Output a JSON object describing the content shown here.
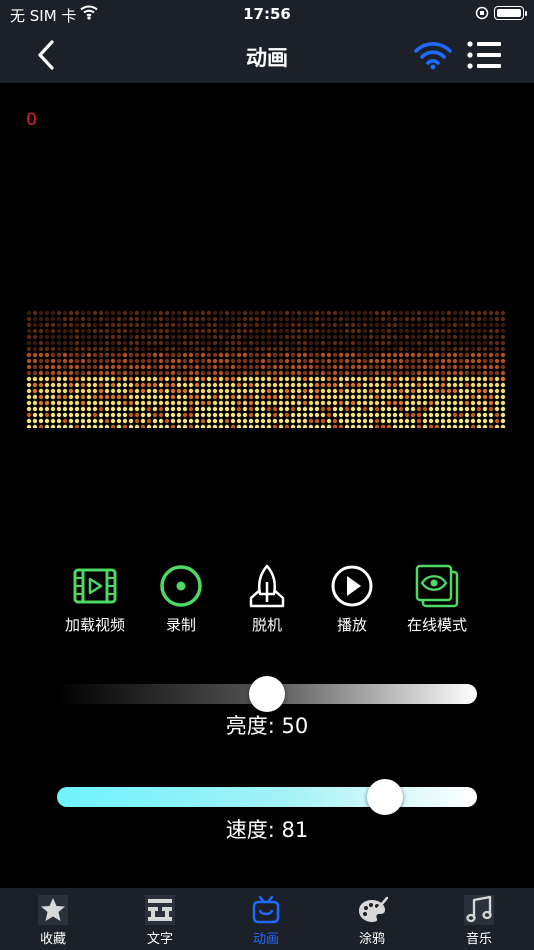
{
  "status_bar": {
    "carrier": "无 SIM 卡",
    "time": "17:56"
  },
  "nav": {
    "title": "动画"
  },
  "counter": "0",
  "actions": [
    {
      "label": "加载视频",
      "icon": "video-film-icon",
      "color": "#4cd964"
    },
    {
      "label": "录制",
      "icon": "record-icon",
      "color": "#4cd964"
    },
    {
      "label": "脱机",
      "icon": "rocket-icon",
      "color": "#ffffff"
    },
    {
      "label": "播放",
      "icon": "play-icon",
      "color": "#ffffff"
    },
    {
      "label": "在线模式",
      "icon": "eye-online-icon",
      "color": "#4cd964"
    }
  ],
  "brightness": {
    "label": "亮度: 50",
    "value": 50,
    "max": 100
  },
  "speed": {
    "label": "速度: 81",
    "value": 81,
    "max": 100
  },
  "tabs": [
    {
      "label": "收藏",
      "icon": "star-icon",
      "active": false
    },
    {
      "label": "文字",
      "icon": "text-icon",
      "active": false
    },
    {
      "label": "动画",
      "icon": "animation-icon",
      "active": true
    },
    {
      "label": "涂鸦",
      "icon": "palette-icon",
      "active": false
    },
    {
      "label": "音乐",
      "icon": "music-icon",
      "active": false
    }
  ],
  "colors": {
    "accent": "#1f6aff",
    "green": "#4cd964",
    "bar_bg": "#1c2129",
    "counter": "#e02020"
  }
}
